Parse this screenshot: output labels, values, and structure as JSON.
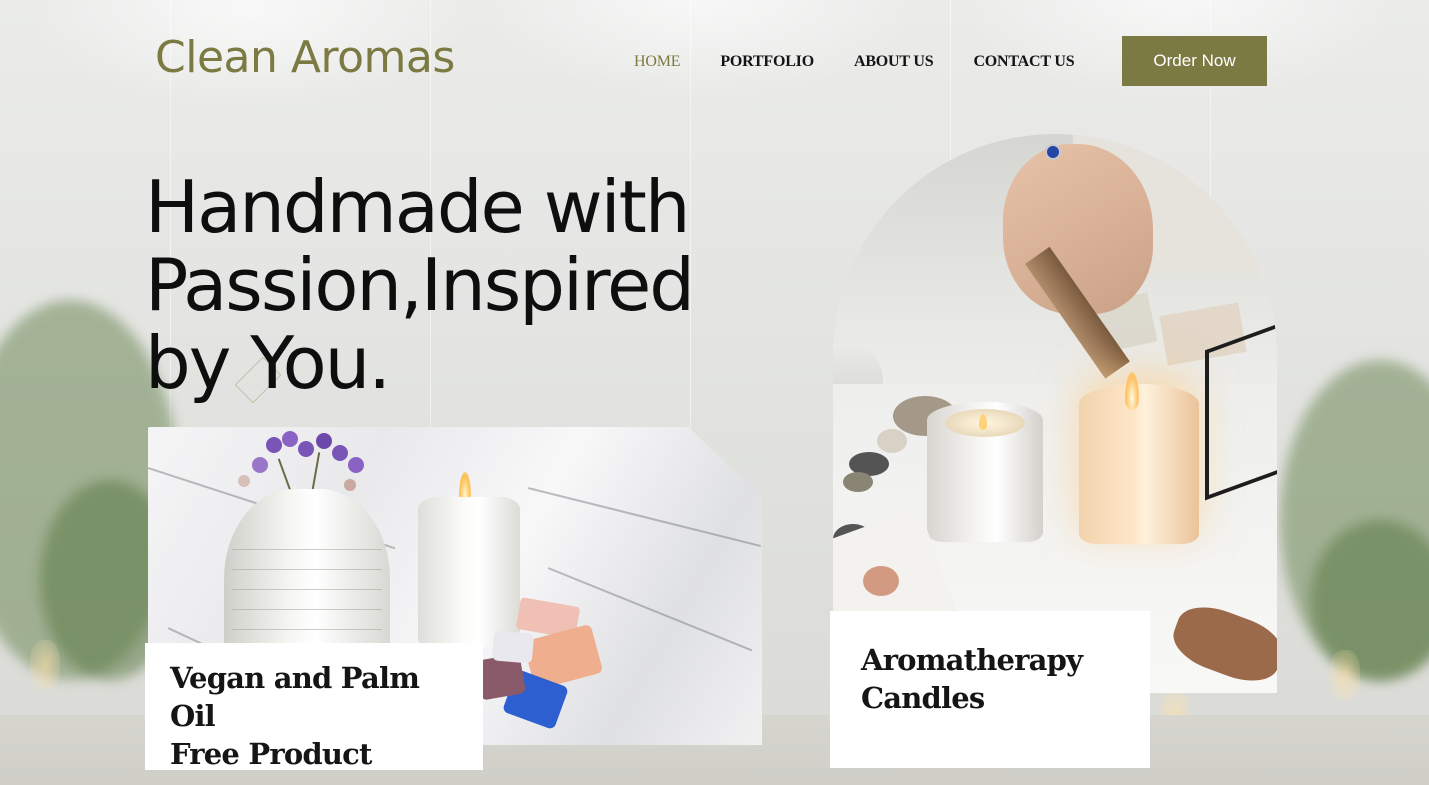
{
  "brand": {
    "name": "Clean Aromas"
  },
  "nav": {
    "items": [
      {
        "label": "HOME",
        "active": true
      },
      {
        "label": "PORTFOLIO",
        "active": false
      },
      {
        "label": "ABOUT US",
        "active": false
      },
      {
        "label": "CONTACT US",
        "active": false
      }
    ],
    "cta_label": "Order Now"
  },
  "hero": {
    "title_lines": [
      "Handmade with",
      "Passion,Inspired",
      "by You."
    ]
  },
  "cards": {
    "left": {
      "title_lines": [
        "Vegan and Palm Oil",
        "Free Product"
      ]
    },
    "right": {
      "title_lines": [
        "Aromatherapy",
        "Candles"
      ]
    }
  },
  "colors": {
    "accent": "#7c7a43",
    "text": "#0e0e0e",
    "card_bg": "#ffffff",
    "page_bg": "#e6e7e4"
  }
}
